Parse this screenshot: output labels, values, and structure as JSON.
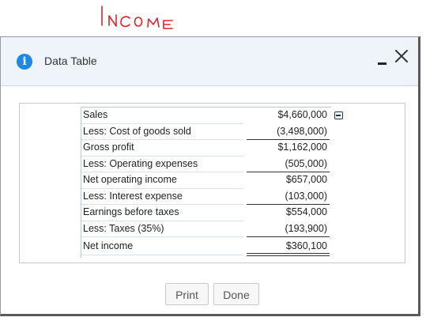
{
  "annotation": {
    "handwritten_text": "INCOME",
    "color": "#e0202a"
  },
  "dialog": {
    "title": "Data Table",
    "info_icon": "i",
    "header_bg": "#eef4fa",
    "accent": "#1e88e5"
  },
  "table": {
    "rows": [
      {
        "label": "Sales",
        "value": "$4,660,000"
      },
      {
        "label": "Less: Cost of goods sold",
        "value": "(3,498,000)"
      },
      {
        "label": "Gross profit",
        "value": "$1,162,000"
      },
      {
        "label": "Less: Operating expenses",
        "value": "(505,000)"
      },
      {
        "label": "Net operating income",
        "value": "$657,000"
      },
      {
        "label": "Less: Interest expense",
        "value": "(103,000)"
      },
      {
        "label": "Earnings before taxes",
        "value": "$554,000"
      },
      {
        "label": "Less: Taxes (35%)",
        "value": "(193,900)"
      },
      {
        "label": "Net income",
        "value": "$360,100"
      }
    ]
  },
  "buttons": {
    "print": "Print",
    "done": "Done"
  }
}
